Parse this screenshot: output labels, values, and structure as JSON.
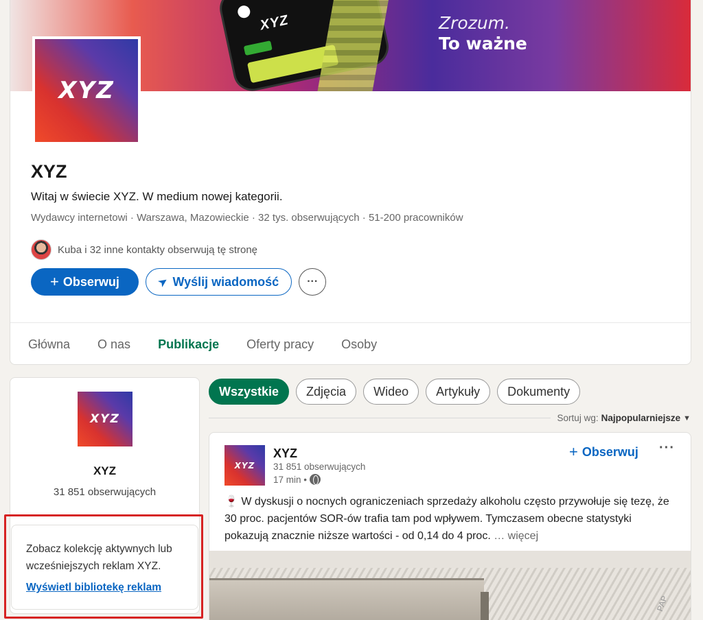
{
  "banner": {
    "phone_logo": "XYZ",
    "tagline_line1": "Zrozum.",
    "tagline_line2": "To ważne"
  },
  "company": {
    "logo_text": "XYZ",
    "name": "XYZ",
    "tagline": "Witaj w świecie XYZ. W medium nowej kategorii.",
    "meta": "Wydawcy internetowi · Warszawa, Mazowieckie · 32 tys. obserwujących · 51-200 pracowników",
    "connections": "Kuba i 32 inne kontakty obserwują tę stronę"
  },
  "actions": {
    "follow": "Obserwuj",
    "message": "Wyślij wiadomość",
    "more": "···"
  },
  "tabs": [
    {
      "label": "Główna"
    },
    {
      "label": "O nas"
    },
    {
      "label": "Publikacje",
      "active": true
    },
    {
      "label": "Oferty pracy"
    },
    {
      "label": "Osoby"
    }
  ],
  "sidebar": {
    "name": "XYZ",
    "followers": "31 851 obserwujących",
    "ads_text": "Zobacz kolekcję aktywnych lub wcześniejszych reklam XYZ.",
    "ads_link": "Wyświetl bibliotekę reklam"
  },
  "filters": [
    {
      "label": "Wszystkie",
      "active": true
    },
    {
      "label": "Zdjęcia"
    },
    {
      "label": "Wideo"
    },
    {
      "label": "Artykuły"
    },
    {
      "label": "Dokumenty"
    }
  ],
  "sort": {
    "label": "Sortuj wg:",
    "value": "Najpopularniejsze"
  },
  "post": {
    "author": "XYZ",
    "followers": "31 851 obserwujących",
    "time": "17 min •",
    "follow": "Obserwuj",
    "menu": "···",
    "body": "🍷 W dyskusji o nocnych ograniczeniach sprzedaży alkoholu często przywołuje się tezę, że 30 proc. pacjentów SOR-ów trafia tam pod wpływem. Tymczasem obecne statystyki pokazują znacznie niższe wartości - od 0,14 do 4 proc.",
    "more": "… więcej",
    "image_sign": "PAP"
  },
  "colors": {
    "accent_blue": "#0a66c2",
    "accent_green": "#01754f",
    "highlight_red": "#d62222"
  },
  "icons": {
    "plus": "+",
    "send": "➤"
  }
}
